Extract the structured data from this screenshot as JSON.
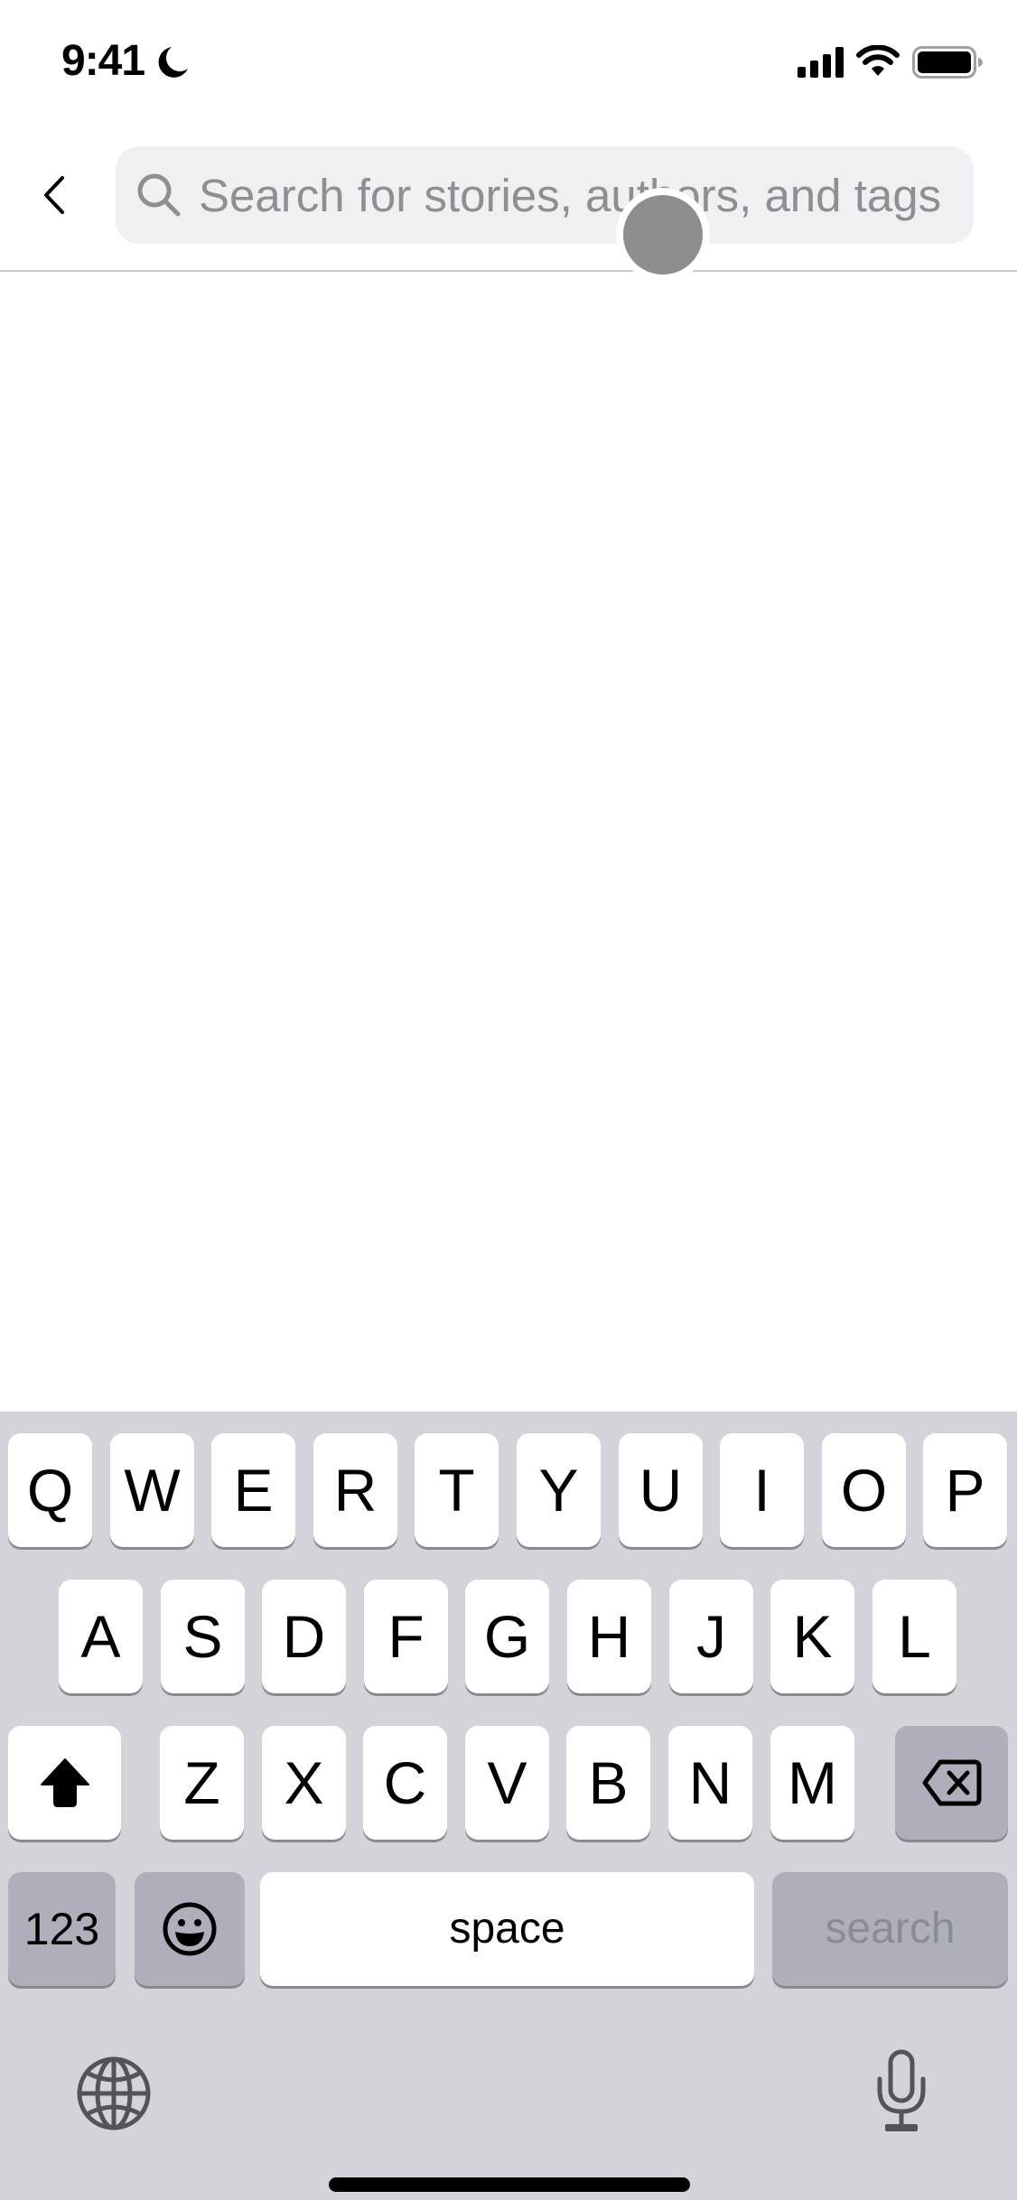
{
  "status_bar": {
    "time": "9:41",
    "focus_icon": "moon-icon",
    "signal_icon": "cellular-signal-icon",
    "wifi_icon": "wifi-icon",
    "battery_icon": "battery-icon"
  },
  "nav": {
    "back_icon": "chevron-left-icon",
    "search": {
      "placeholder": "Search for stories, authors, and tags",
      "value": "",
      "icon": "magnifying-glass-icon"
    }
  },
  "keyboard": {
    "row1": [
      "Q",
      "W",
      "E",
      "R",
      "T",
      "Y",
      "U",
      "I",
      "O",
      "P"
    ],
    "row2": [
      "A",
      "S",
      "D",
      "F",
      "G",
      "H",
      "J",
      "K",
      "L"
    ],
    "row3": [
      "Z",
      "X",
      "C",
      "V",
      "B",
      "N",
      "M"
    ],
    "shift_icon": "shift-arrow-icon",
    "delete_icon": "delete-backspace-icon",
    "numbers_label": "123",
    "emoji_icon": "emoji-smiley-icon",
    "space_label": "space",
    "return_label": "search",
    "globe_icon": "globe-icon",
    "mic_icon": "microphone-icon"
  },
  "colors": {
    "keyboard_bg": "#d3d4da",
    "key_light": "#ffffff",
    "key_dark": "#adb0bb",
    "search_bg": "#efeff4",
    "placeholder": "#8e8e93"
  }
}
